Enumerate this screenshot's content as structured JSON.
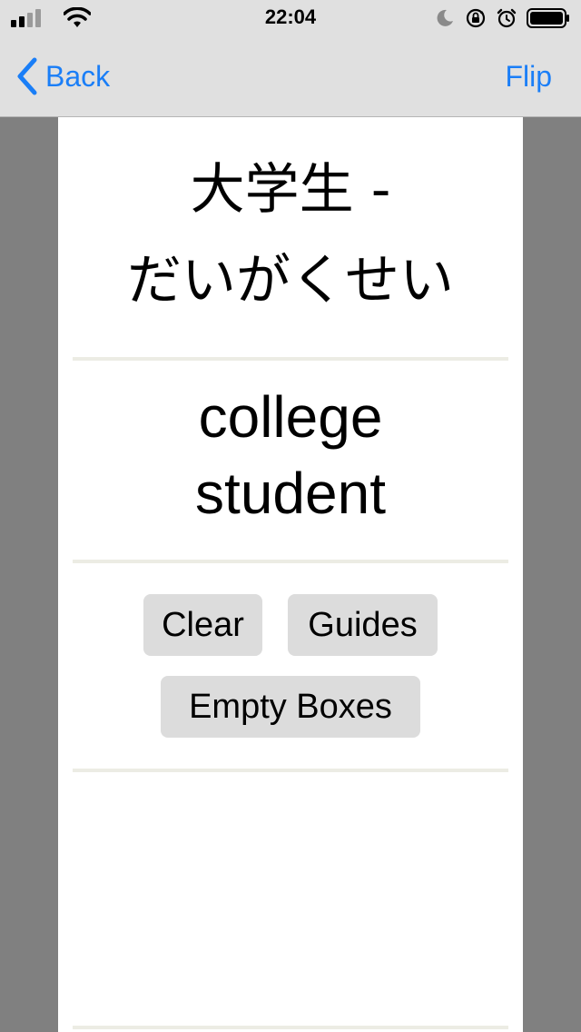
{
  "status_bar": {
    "time": "22:04",
    "icons": [
      "signal-icon",
      "wifi-icon",
      "moon-icon",
      "orientation-lock-icon",
      "alarm-icon",
      "battery-icon"
    ]
  },
  "nav": {
    "back_label": "Back",
    "flip_label": "Flip",
    "accent_color": "#1a7ef7"
  },
  "card": {
    "kanji_line": "大学生 -",
    "kana_line": "だいがくせい",
    "meaning_line1": "college",
    "meaning_line2": "student"
  },
  "buttons": {
    "clear": "Clear",
    "guides": "Guides",
    "empty_boxes": "Empty Boxes"
  },
  "colors": {
    "background": "#808080",
    "bar": "#e0e0e0",
    "card": "#ffffff",
    "button": "#dcdcdc",
    "divider": "#ecece4"
  }
}
